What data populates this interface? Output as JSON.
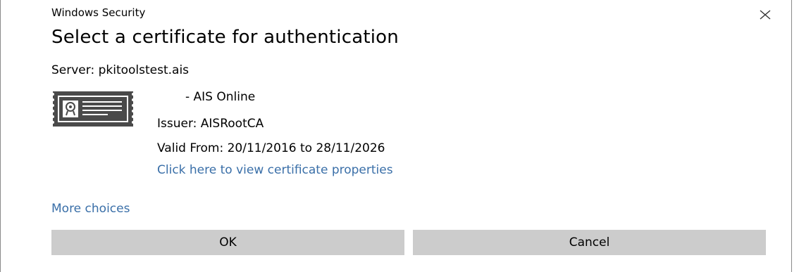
{
  "window": {
    "title": "Windows Security",
    "close_icon": "close-icon"
  },
  "dialog": {
    "heading": "Select a certificate for authentication",
    "server": "Server: pkitoolstest.ais"
  },
  "certificate": {
    "icon": "certificate-icon",
    "name": "- AIS Online",
    "issuer": "Issuer: AISRootCA",
    "valid": "Valid From: 20/11/2016 to 28/11/2026",
    "properties_link": "Click here to view certificate properties"
  },
  "more_choices": "More choices",
  "buttons": {
    "ok": "OK",
    "cancel": "Cancel"
  },
  "colors": {
    "link": "#3a6fa8",
    "button_bg": "#cccccc",
    "icon_dark": "#4a4a4a"
  }
}
